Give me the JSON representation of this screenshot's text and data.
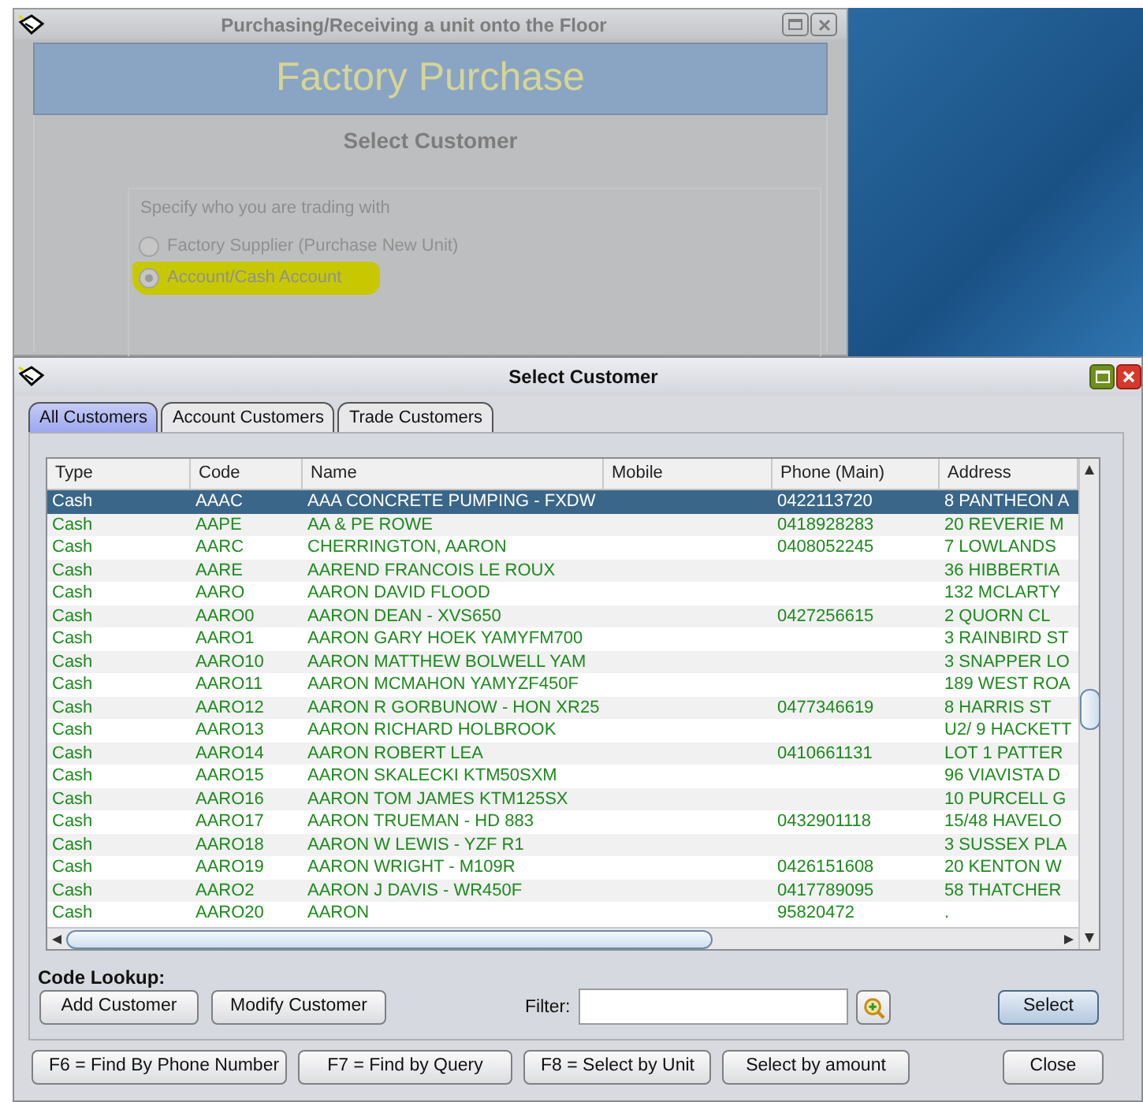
{
  "background_window": {
    "title": "Purchasing/Receiving a unit onto the Floor",
    "banner": "Factory Purchase",
    "heading": "Select Customer",
    "group_label": "Specify who you are trading with",
    "options": [
      {
        "label": "Factory Supplier (Purchase New Unit)",
        "selected": false,
        "highlighted": false
      },
      {
        "label": "Account/Cash Account",
        "selected": true,
        "highlighted": true
      }
    ]
  },
  "dialog": {
    "title": "Select Customer",
    "tabs": [
      {
        "label": "All Customers",
        "selected": true
      },
      {
        "label": "Account Customers",
        "selected": false
      },
      {
        "label": "Trade Customers",
        "selected": false
      }
    ],
    "columns": [
      "Type",
      "Code",
      "Name",
      "Mobile",
      "Phone (Main)",
      "Address"
    ],
    "rows": [
      {
        "type": "Cash",
        "code": "AAAC",
        "name": "AAA CONCRETE PUMPING - FXDW",
        "phone": "0422113720",
        "address": "8 PANTHEON A",
        "selected": true
      },
      {
        "type": "Cash",
        "code": "AAPE",
        "name": "AA & PE ROWE",
        "phone": "0418928283",
        "address": "20 REVERIE M",
        "selected": false
      },
      {
        "type": "Cash",
        "code": "AARC",
        "name": "CHERRINGTON, AARON",
        "phone": "0408052245",
        "address": "7 LOWLANDS",
        "selected": false
      },
      {
        "type": "Cash",
        "code": "AARE",
        "name": "AAREND FRANCOIS LE ROUX",
        "address": "36 HIBBERTIA",
        "selected": false
      },
      {
        "type": "Cash",
        "code": "AARO",
        "name": "AARON DAVID FLOOD",
        "address": "132 MCLARTY",
        "selected": false
      },
      {
        "type": "Cash",
        "code": "AARO0",
        "name": "AARON DEAN - XVS650",
        "phone": "0427256615",
        "address": "2 QUORN CL",
        "selected": false
      },
      {
        "type": "Cash",
        "code": "AARO1",
        "name": "AARON GARY HOEK YAMYFM700",
        "address": "3 RAINBIRD ST",
        "selected": false
      },
      {
        "type": "Cash",
        "code": "AARO10",
        "name": "AARON MATTHEW BOLWELL YAM",
        "address": "3 SNAPPER LO",
        "selected": false
      },
      {
        "type": "Cash",
        "code": "AARO11",
        "name": "AARON MCMAHON YAMYZF450F",
        "address": "189 WEST ROA",
        "selected": false
      },
      {
        "type": "Cash",
        "code": "AARO12",
        "name": "AARON R GORBUNOW - HON XR25",
        "phone": "0477346619",
        "address": "8 HARRIS ST",
        "selected": false
      },
      {
        "type": "Cash",
        "code": "AARO13",
        "name": "AARON RICHARD HOLBROOK",
        "address": "U2/ 9 HACKETT",
        "selected": false
      },
      {
        "type": "Cash",
        "code": "AARO14",
        "name": "AARON ROBERT LEA",
        "phone": "0410661131",
        "address": "LOT 1 PATTER",
        "selected": false
      },
      {
        "type": "Cash",
        "code": "AARO15",
        "name": "AARON SKALECKI KTM50SXM",
        "address": "96 VIAVISTA D",
        "selected": false
      },
      {
        "type": "Cash",
        "code": "AARO16",
        "name": "AARON TOM JAMES KTM125SX",
        "address": "10 PURCELL G",
        "selected": false
      },
      {
        "type": "Cash",
        "code": "AARO17",
        "name": "AARON TRUEMAN - HD 883",
        "phone": "0432901118",
        "address": "15/48 HAVELO",
        "selected": false
      },
      {
        "type": "Cash",
        "code": "AARO18",
        "name": "AARON W LEWIS - YZF R1",
        "address": "3 SUSSEX PLA",
        "selected": false
      },
      {
        "type": "Cash",
        "code": "AARO19",
        "name": "AARON WRIGHT - M109R",
        "phone": "0426151608",
        "address": "20 KENTON W",
        "selected": false
      },
      {
        "type": "Cash",
        "code": "AARO2",
        "name": "AARON J DAVIS - WR450F",
        "phone": "0417789095",
        "address": "58 THATCHER",
        "selected": false
      },
      {
        "type": "Cash",
        "code": "AARO20",
        "name": "AARON",
        "phone": "95820472",
        "address": ".",
        "selected": false
      }
    ],
    "code_lookup_label": "Code Lookup:",
    "action_buttons": [
      "Add Customer",
      "Modify Customer"
    ],
    "filter": {
      "label": "Filter:"
    },
    "select_button": "Select",
    "bottom_buttons": [
      "F6 = Find By Phone Number",
      "F7 = Find by Query",
      "F8 = Select by Unit",
      "Select by amount"
    ],
    "close_button": "Close"
  }
}
